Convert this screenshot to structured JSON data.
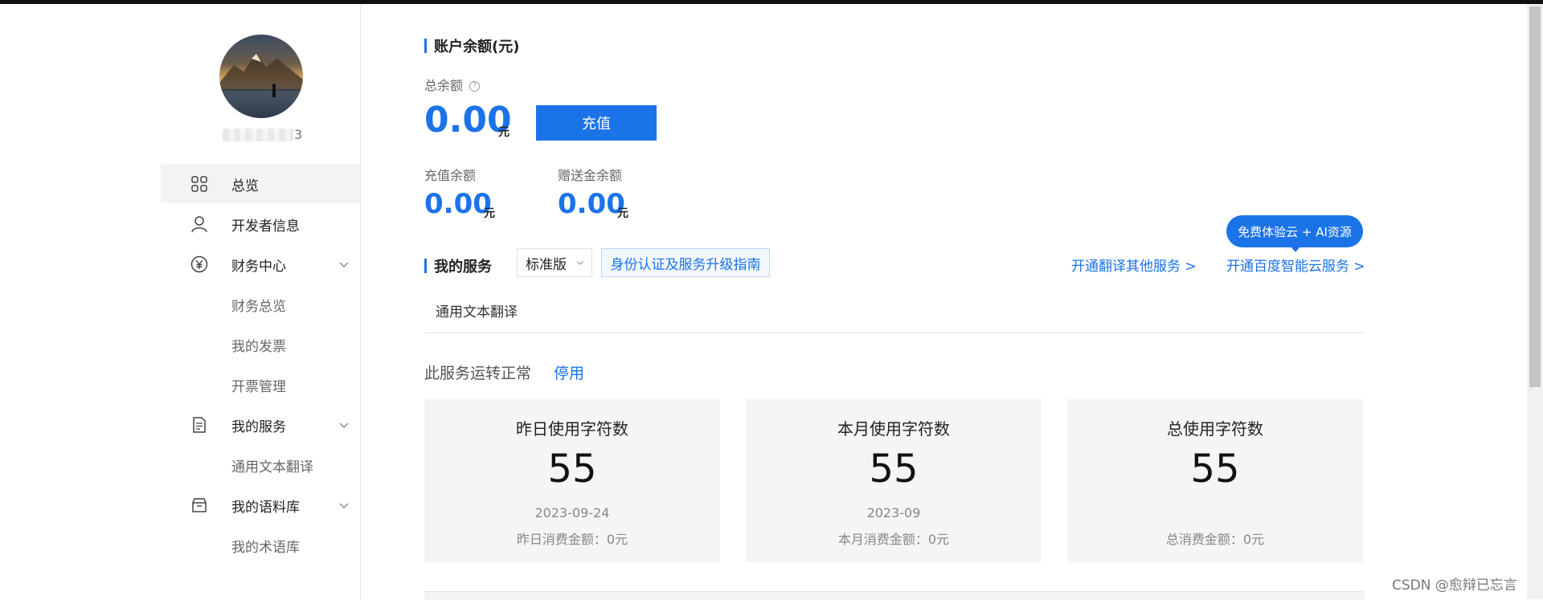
{
  "colors": {
    "accent": "#1b73e8",
    "card_bg": "#f5f5f5",
    "text": "#222222"
  },
  "sidebar": {
    "username_suffix": "3",
    "items": [
      {
        "label": "总览",
        "icon": "grid-icon"
      },
      {
        "label": "开发者信息",
        "icon": "user-icon"
      },
      {
        "label": "财务中心",
        "icon": "yuan-icon"
      },
      {
        "label": "财务总览"
      },
      {
        "label": "我的发票"
      },
      {
        "label": "开票管理"
      },
      {
        "label": "我的服务",
        "icon": "document-icon"
      },
      {
        "label": "通用文本翻译"
      },
      {
        "label": "我的语料库",
        "icon": "box-icon"
      },
      {
        "label": "我的术语库"
      }
    ]
  },
  "balance": {
    "title": "账户余额(元)",
    "total_label": "总余额",
    "total_value": "0.00",
    "unit": "元",
    "recharge_label": "充值",
    "recharge_balance_label": "充值余额",
    "recharge_balance_value": "0.00",
    "gift_balance_label": "赠送金余额",
    "gift_balance_value": "0.00"
  },
  "services": {
    "title": "我的服务",
    "edition": "标准版",
    "guide_label": "身份认证及服务升级指南",
    "link_other": "开通翻译其他服务 >",
    "link_baidu": "开通百度智能云服务 >",
    "bubble": "免费体验云 + AI资源",
    "tab": "通用文本翻译",
    "status_text": "此服务运转正常",
    "stop_label": "停用"
  },
  "cards": [
    {
      "title": "昨日使用字符数",
      "value": "55",
      "date": "2023-09-24",
      "fee": "昨日消费金额：0元"
    },
    {
      "title": "本月使用字符数",
      "value": "55",
      "date": "2023-09",
      "fee": "本月消费金额：0元"
    },
    {
      "title": "总使用字符数",
      "value": "55",
      "date": "",
      "fee": "总消费金额：0元"
    }
  ],
  "watermark": "CSDN @愈辩已忘言"
}
